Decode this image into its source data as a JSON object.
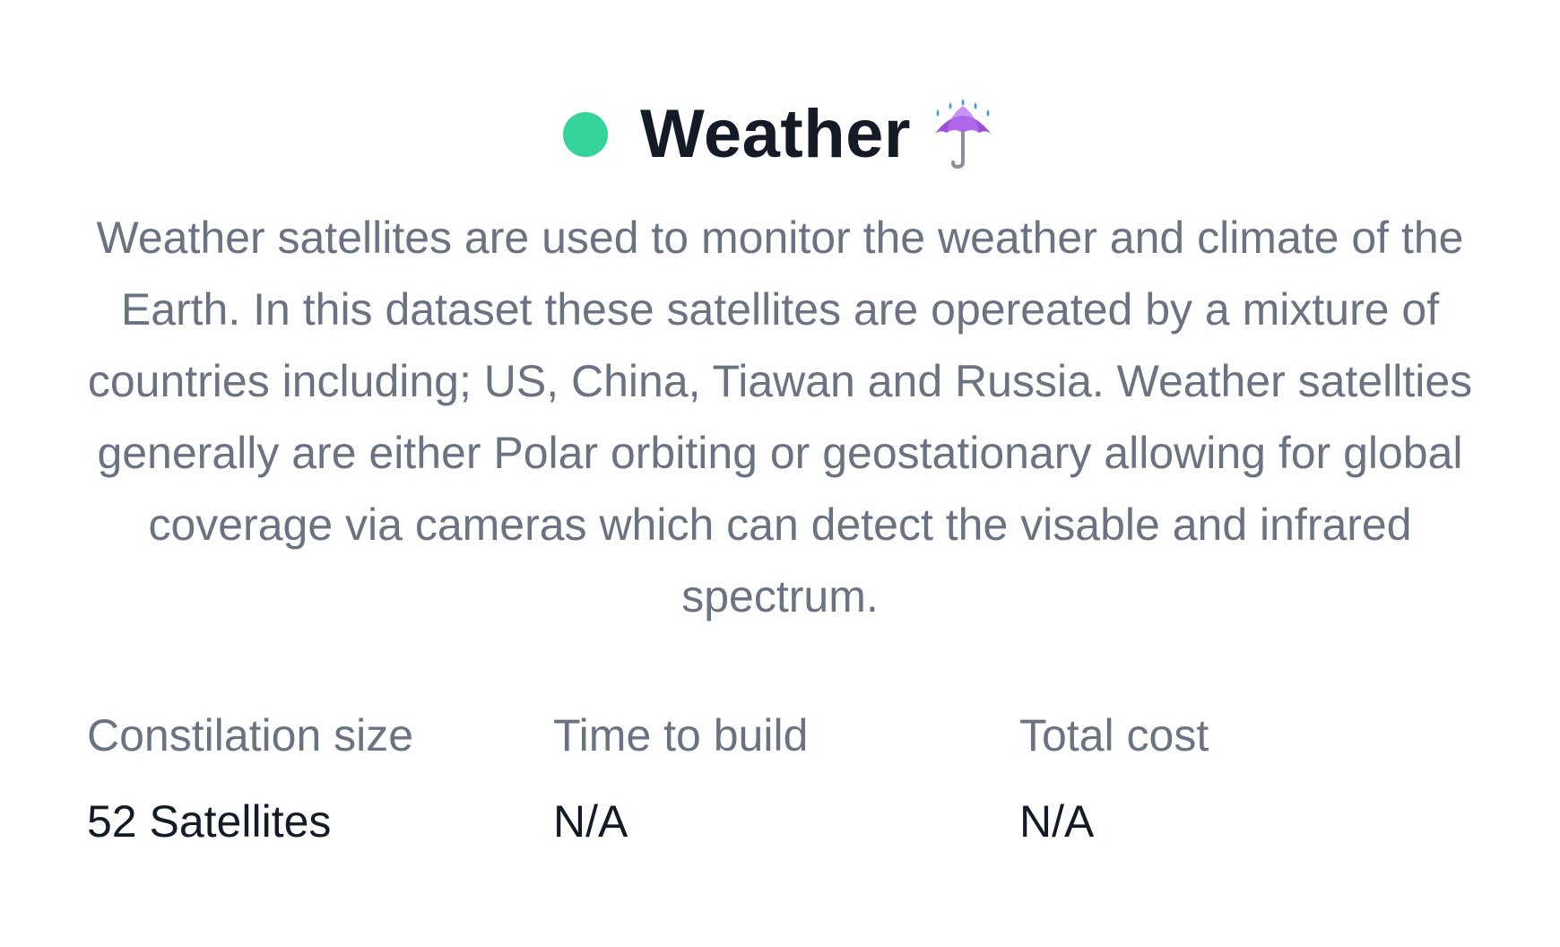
{
  "card": {
    "status_color": "#34d399",
    "title": "Weather",
    "title_icon": "umbrella-with-rain-icon",
    "description": "Weather satellites are used to monitor the weather and climate of the Earth. In this dataset these satellites are opereated by a mixture of countries including; US, China, Tiawan and Russia. Weather satellties generally are either Polar orbiting or geostationary allowing for global coverage via cameras which can detect the visable and infrared spectrum."
  },
  "stats": [
    {
      "label": "Constilation size",
      "value": "52 Satellites"
    },
    {
      "label": "Time to build",
      "value": "N/A"
    },
    {
      "label": "Total cost",
      "value": "N/A"
    }
  ]
}
